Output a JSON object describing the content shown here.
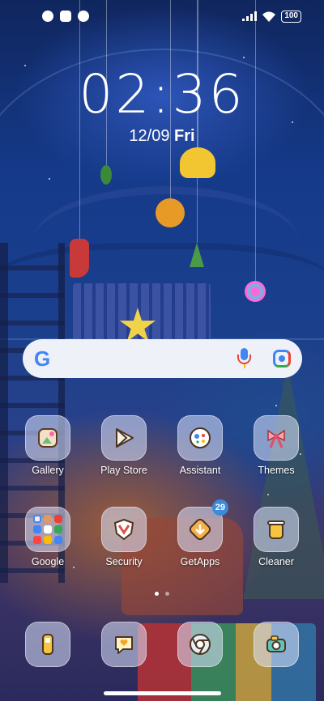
{
  "status_bar": {
    "battery": "100",
    "left_icons": [
      "notification-icon",
      "square-icon",
      "notification-icon"
    ],
    "right_icons": [
      "signal-icon",
      "wifi-icon",
      "battery-icon"
    ]
  },
  "lockclock": {
    "time": "02:36",
    "date": "12/09",
    "weekday": "Fri"
  },
  "search_bar": {
    "logo": "G",
    "icons": [
      "google-logo-icon",
      "microphone-icon",
      "lens-icon"
    ]
  },
  "apps": [
    {
      "label": "Gallery",
      "icon": "gallery-icon"
    },
    {
      "label": "Play Store",
      "icon": "play-store-icon"
    },
    {
      "label": "Assistant",
      "icon": "assistant-icon"
    },
    {
      "label": "Themes",
      "icon": "ribbon-icon"
    },
    {
      "label": "Google",
      "icon": "folder-icon"
    },
    {
      "label": "Security",
      "icon": "shield-icon"
    },
    {
      "label": "GetApps",
      "icon": "download-icon",
      "badge": "29"
    },
    {
      "label": "Cleaner",
      "icon": "trash-icon"
    }
  ],
  "dock": [
    {
      "icon": "phone-icon"
    },
    {
      "icon": "message-icon"
    },
    {
      "icon": "chrome-icon"
    },
    {
      "icon": "camera-icon"
    }
  ],
  "colors": {
    "accent": "#4285f4",
    "badge": "#3a8bd9"
  }
}
